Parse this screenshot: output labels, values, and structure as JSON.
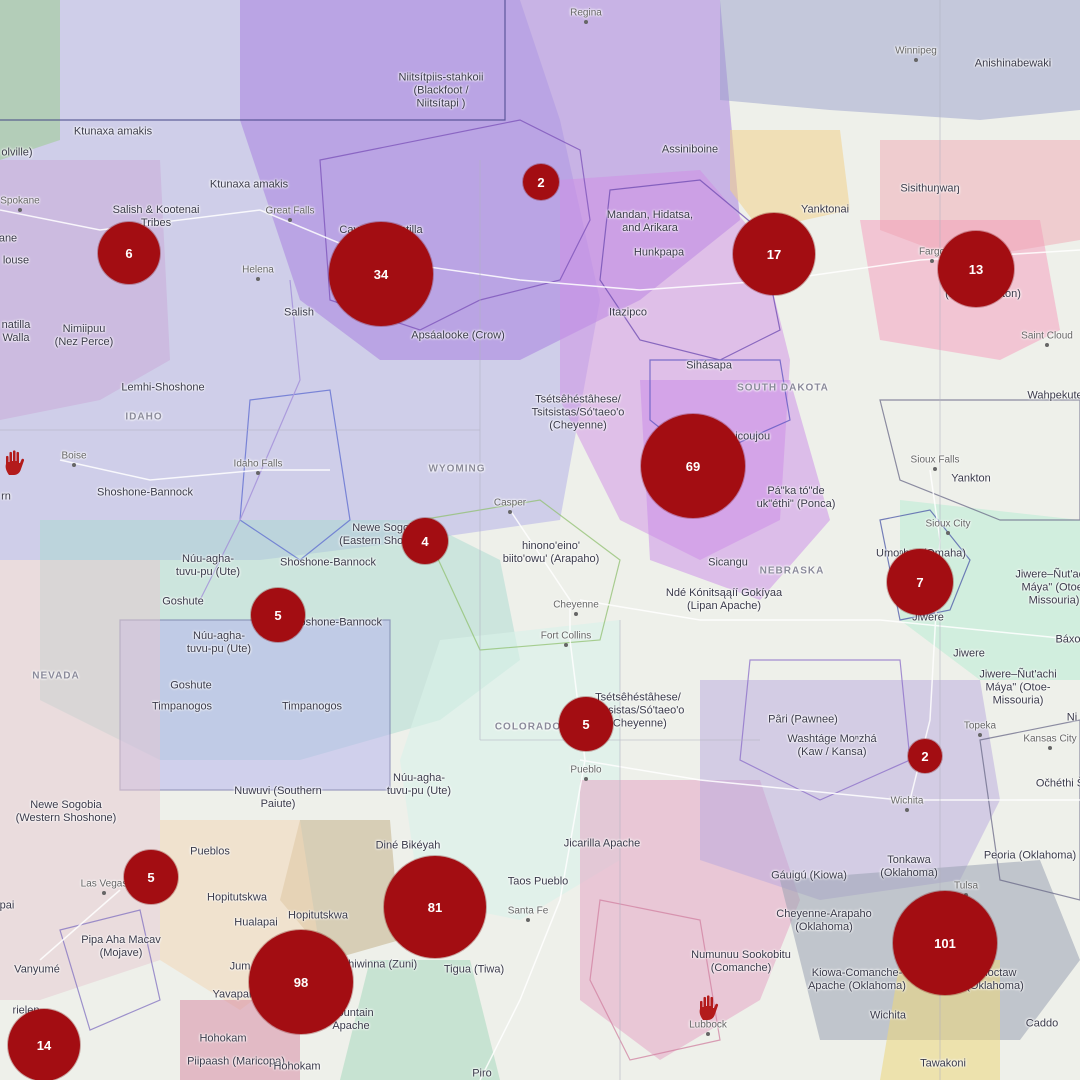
{
  "map": {
    "state_labels": [
      "IDAHO",
      "WYOMING",
      "NEVADA",
      "COLORADO",
      "NEBRASKA",
      "SOUTH DAKOTA"
    ],
    "city_labels": [
      "Regina",
      "Winnipeg",
      "Great Falls",
      "Helena",
      "Spokane",
      "Boise",
      "Idaho Falls",
      "Casper",
      "Cheyenne",
      "Fort Collins",
      "Pueblo",
      "Santa Fe",
      "Las Vegas",
      "Fargo",
      "Saint Cloud",
      "Sioux Falls",
      "Sioux City",
      "Topeka",
      "Kansas City",
      "Wichita",
      "Tulsa",
      "Lubbock"
    ],
    "territory_labels": [
      "Niitsítpiis-stahkoii\n(Blackfoot /\nNiitsítapi )",
      "Ktunaxa amakis",
      "Ktunaxa amakis",
      "Salish & Kootenai\nTribes",
      "Cayuse, Umatilla\nand Walla Walla",
      "Nimiipuu\n(Nez Perce)",
      "Lemhi-Shoshone",
      "Shoshone-Bannock",
      "Salish",
      "Apsáalooke (Crow)",
      "Assiniboine",
      "Mandan, Hidatsa,\nand Arikara",
      "Hunkpapa",
      "Yanktonai",
      "Sisithuŋwaŋ",
      "Anishinabewaki",
      "Itazipco",
      "Sihásapa",
      "Tsétsêhéstâhese/\nTsitsistas/Só'taeo'o\n(Cheyenne)",
      "Mnicoujou",
      "Pá\"ka tó\"de\nuk\"éthi\" (Ponca)",
      "Yankton",
      "Wahpekute",
      "Newe Sogobia\n(Eastern Shoshone)",
      "hinono'eino'\nbiito'owu' (Arapaho)",
      "Sicangu",
      "Ndé Kónitsąąíí Gokíyaa\n(Lipan Apache)",
      "Umoⁿhoⁿ (Omaha)",
      "Jiwere–Ñut'achi\nMáya\" (Otoe-\nMissouria)",
      "Jiwere",
      "Jiwere",
      "Jiwere–Ñut'achi\nMáya\" (Otoe-\nMissouria)",
      "Núu-agha-\ntuvu-pu (Ute)",
      "Shoshone-Bannock",
      "Goshute",
      "Núu-agha-\ntuvu-pu (Ute)",
      "Shoshone-Bannock",
      "Goshute",
      "Timpanogos",
      "Timpanogos",
      "Tsétsêhéstâhese/\nTsitsistas/Só'taeo'o\n(Cheyenne)",
      "Pâri (Pawnee)",
      "Washtáge Moⁿzhá\n(Kaw / Kansa)",
      "Nuwuvi (Southern\nPaiute)",
      "Núu-agha-\ntuvu-pu (Ute)",
      "Newe Sogobia\n(Western Shoshone)",
      "Pueblos",
      "Diné Bikéyah",
      "Jicarilla Apache",
      "Taos Pueblo",
      "Hopitutskwa",
      "Hopitutskwa",
      "Hualapai",
      "Pipa Aha Macav\n(Mojave)",
      "Vanyumé",
      "Yavapai",
      "Shiwinna (Zuni)",
      "Mountain\nApache",
      "Hohokam",
      "Piipaash (Maricopa)",
      "Hohokam",
      "Tigua (Tiwa)",
      "Piro",
      "Numunuu Sookobitu\n(Comanche)",
      "Gáuigú (Kiowa)",
      "Cheyenne-Arapaho\n(Oklahoma)",
      "Tonkawa\n(Oklahoma)",
      "Peoria (Oklahoma)",
      "Kiowa-Comanche-\nApache (Oklahoma)",
      "Choctaw\n(Oklahoma)",
      "Tawakoni",
      "Caddo",
      "Báxo",
      "Očhéthi Š",
      "Wichita",
      "Boise Forte\n(Mdewakanton)",
      "Ni",
      "olville)",
      "ane",
      "louse",
      "natilla\nWalla",
      "rn",
      "pai",
      "Jum",
      "rielen"
    ],
    "clusters": [
      {
        "count": "2"
      },
      {
        "count": "34"
      },
      {
        "count": "17"
      },
      {
        "count": "13"
      },
      {
        "count": "6"
      },
      {
        "count": "69"
      },
      {
        "count": "4"
      },
      {
        "count": "5"
      },
      {
        "count": "7"
      },
      {
        "count": "5"
      },
      {
        "count": "2"
      },
      {
        "count": "5"
      },
      {
        "count": "81"
      },
      {
        "count": "98"
      },
      {
        "count": "101"
      },
      {
        "count": "14"
      }
    ],
    "colors": {
      "cluster": "#a30d12",
      "hand": "#b31b1b"
    }
  }
}
